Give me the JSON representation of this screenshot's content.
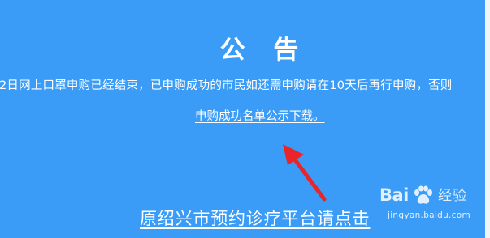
{
  "notice": {
    "title": "公 告",
    "body": "2日网上口罩申购已经结束，已申购成功的市民如还需申购请在10天后再行申购，否则",
    "download_link": "申购成功名单公示下载。",
    "clinic_link": "原绍兴市预约诊疗平台请点击"
  },
  "watermark": {
    "logo": "Bai",
    "logo_suffix": "经验",
    "url": "jingyan.baidu.com"
  },
  "colors": {
    "background": "#3a9cf6",
    "text": "#ffffff",
    "arrow": "#e8262a"
  },
  "icons": {
    "annotation": "red-arrow-icon",
    "brand": "baidu-paw-icon"
  }
}
